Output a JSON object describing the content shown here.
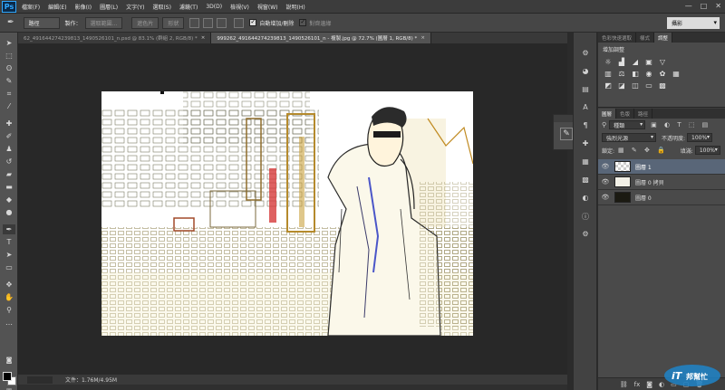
{
  "app": {
    "logo": "Ps",
    "accent": "#31a8ff"
  },
  "menu": [
    "檔案(F)",
    "編輯(E)",
    "影像(I)",
    "圖層(L)",
    "文字(Y)",
    "選取(S)",
    "濾鏡(T)",
    "3D(D)",
    "檢視(V)",
    "視窗(W)",
    "說明(H)"
  ],
  "window_controls": {
    "minimize": "—",
    "restore": "□",
    "close": "✕"
  },
  "options": {
    "mode": "路徑",
    "make_label": "製作：",
    "selection_btn": "選取範圍...",
    "mask_btn": "遮色片",
    "shape_btn": "形狀",
    "auto_add_delete": "自動增加/刪除",
    "align_edges": "對齊邊緣",
    "workspace": "攝影"
  },
  "tabs": [
    {
      "title": "62_491644274239813_1490526101_n.psd @ 83.1% (群組 2, RGB/8) *",
      "close": "×",
      "active": false
    },
    {
      "title": "999262_491644274239813_1490526101_n - 複製.jpg @ 72.7% (圖層 1, RGB/8) *",
      "close": "×",
      "active": true
    }
  ],
  "status": {
    "file": "文件：1.76M/4.95M"
  },
  "adjust_panel": {
    "tabs": [
      "色彩快速選取",
      "樣式",
      "調整"
    ],
    "title": "增加調整",
    "icons_row1": [
      "brightness-icon",
      "levels-icon",
      "curves-icon",
      "exposure-icon",
      "triangle-icon"
    ],
    "icons_row2": [
      "vibrance-icon",
      "balance-icon",
      "bw-icon",
      "photo-filter-icon",
      "mixer-icon",
      "lookup-icon"
    ],
    "icons_row3": [
      "invert-icon",
      "posterize-icon",
      "threshold-icon",
      "gradient-map-icon",
      "selective-color-icon"
    ]
  },
  "layers_panel": {
    "tabs": [
      "圖層",
      "色版",
      "路徑"
    ],
    "filter": "種類",
    "blend_mode": "強烈光源",
    "opacity_label": "不透明度:",
    "opacity": "100%",
    "lock_label": "鎖定:",
    "fill_label": "填滿:",
    "fill": "100%",
    "layers": [
      {
        "name": "圖層 1",
        "selected": true
      },
      {
        "name": "圖層 0 拷貝",
        "selected": false
      },
      {
        "name": "圖層 0",
        "selected": false
      }
    ]
  },
  "watermark": {
    "text": "iT邦幫忙"
  }
}
